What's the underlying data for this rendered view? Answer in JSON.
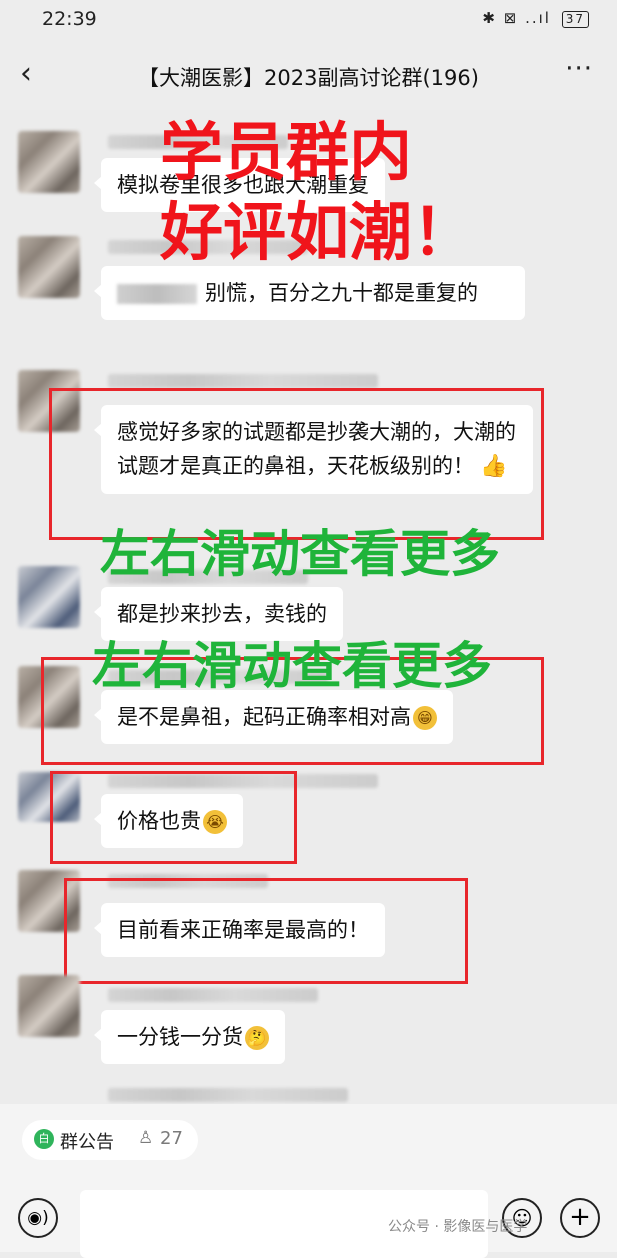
{
  "status_bar": {
    "time": "22:39",
    "icons": "✱ ⊠ ..ıl",
    "battery": "37"
  },
  "header": {
    "back": "‹",
    "title": "【大潮医影】2023副高讨论群(196)",
    "more": "···"
  },
  "messages": [
    {
      "text": "模拟卷里很多也跟大潮重复"
    },
    {
      "text": "别慌，百分之九十都是重复的"
    },
    {
      "text": "感觉好多家的试题都是抄袭大潮的，大潮的试题才是真正的鼻祖，天花板级别的！",
      "emoji": "👍"
    },
    {
      "text": "都是抄来抄去，卖钱的"
    },
    {
      "text": "是不是鼻祖，起码正确率相对高",
      "emoji": "😁"
    },
    {
      "text": "价格也贵",
      "emoji": "😭"
    },
    {
      "text": "目前看来正确率是最高的！"
    },
    {
      "text": "一分钱一分货",
      "emoji": "🤔"
    }
  ],
  "overlays": {
    "red_line1": "学员群内",
    "red_line2": "好评如潮！",
    "green_line": "左右滑动查看更多"
  },
  "bottom": {
    "announcement_label": "群公告",
    "member_count": "27",
    "announcement_icon": "白",
    "voice_icon": "◉)",
    "emoji_icon": "☺",
    "plus_icon": "+"
  },
  "watermark": "公众号 · 影像医与医学"
}
